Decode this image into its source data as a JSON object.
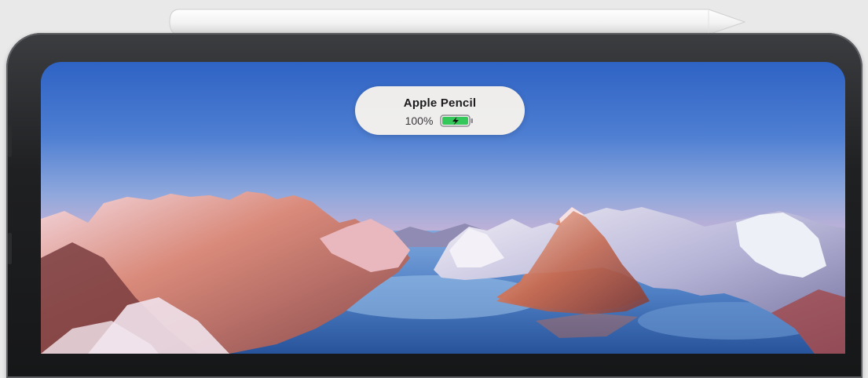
{
  "device": {
    "accessory": "pencil-icon",
    "wallpaper": "snowy-mountains-lake"
  },
  "hud": {
    "title": "Apple Pencil",
    "battery_percent_label": "100%",
    "battery_level": 1.0,
    "battery_icon": "battery-charging-icon",
    "battery_color": "#34c759"
  }
}
